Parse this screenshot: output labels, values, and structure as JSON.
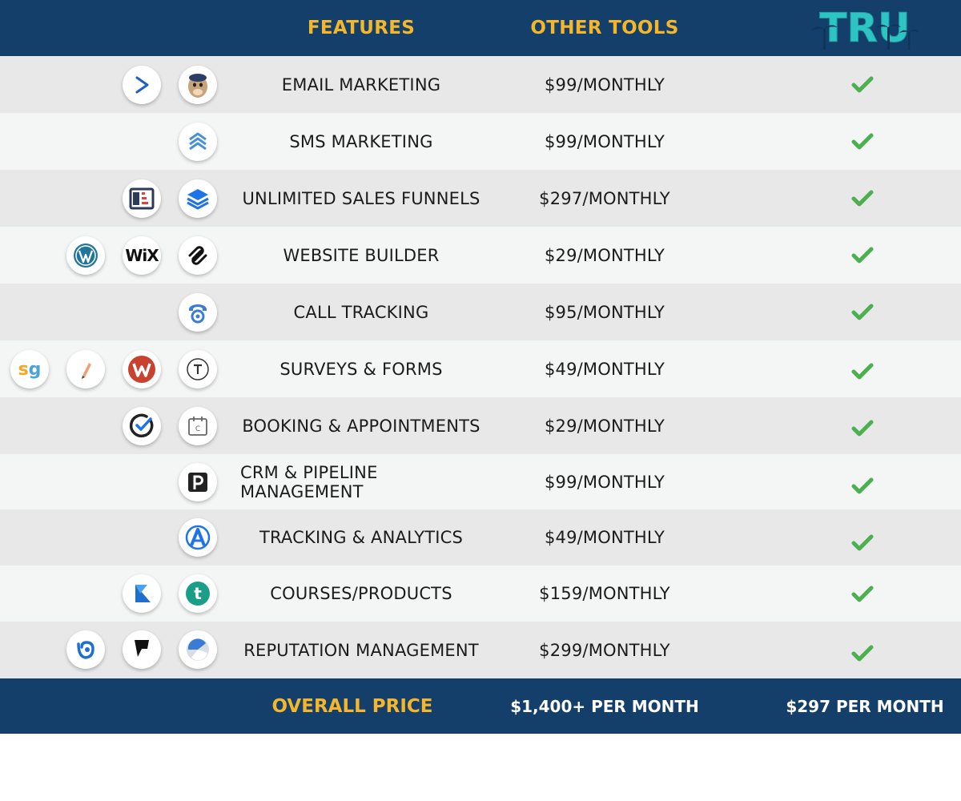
{
  "header": {
    "features_label": "FEATURES",
    "other_tools_label": "OTHER TOOLS",
    "brand_logo": "TRU",
    "brand_color": "#2ec4c4",
    "accent_color": "#f5b62a",
    "bg_color": "#143f6b"
  },
  "rows": [
    {
      "feature": "EMAIL MARKETING",
      "price": "$99/MONTHLY",
      "icons": [
        "activecampaign-icon",
        "mailchimp-icon"
      ]
    },
    {
      "feature": "SMS MARKETING",
      "price": "$99/MONTHLY",
      "icons": [
        "sms-chevrons-icon"
      ]
    },
    {
      "feature": "UNLIMITED SALES FUNNELS",
      "price": "$297/MONTHLY",
      "icons": [
        "clickfunnels-icon",
        "leadpages-layers-icon"
      ]
    },
    {
      "feature": "WEBSITE BUILDER",
      "price": "$29/MONTHLY",
      "icons": [
        "wordpress-icon",
        "wix-icon",
        "squarespace-icon"
      ]
    },
    {
      "feature": "CALL TRACKING",
      "price": "$95/MONTHLY",
      "icons": [
        "calltracking-icon"
      ]
    },
    {
      "feature": "SURVEYS & FORMS",
      "price": "$49/MONTHLY",
      "icons": [
        "surveygizmo-icon",
        "pen-icon",
        "wufoo-icon",
        "typeform-icon"
      ]
    },
    {
      "feature": "BOOKING & APPOINTMENTS",
      "price": "$29/MONTHLY",
      "icons": [
        "acuity-check-icon",
        "calendly-icon"
      ]
    },
    {
      "feature": "CRM & PIPELINE MANAGEMENT",
      "price": "$99/MONTHLY",
      "icons": [
        "pipedrive-icon"
      ]
    },
    {
      "feature": "TRACKING & ANALYTICS",
      "price": "$49/MONTHLY",
      "icons": [
        "analytics-a-icon"
      ]
    },
    {
      "feature": "COURSES/PRODUCTS",
      "price": "$159/MONTHLY",
      "icons": [
        "kajabi-icon",
        "teachable-icon"
      ]
    },
    {
      "feature": "REPUTATION MANAGEMENT",
      "price": "$299/MONTHLY",
      "icons": [
        "birdeye-icon",
        "foursquare-icon",
        "reputation-swirl-icon"
      ]
    }
  ],
  "footer": {
    "label": "OVERALL PRICE",
    "other_total": "$1,400+ PER MONTH",
    "tru_total": "$297 PER MONTH"
  },
  "check_color": "#4caf50"
}
